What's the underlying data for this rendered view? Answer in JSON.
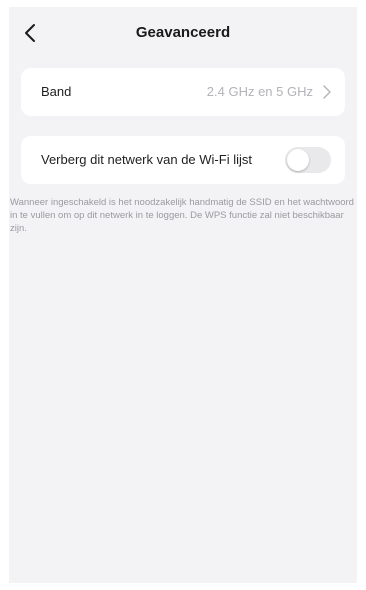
{
  "header": {
    "title": "Geavanceerd",
    "back_icon": "chevron-left-icon"
  },
  "band": {
    "label": "Band",
    "value": "2.4 GHz en 5 GHz",
    "chevron_icon": "chevron-right-icon"
  },
  "hide_network": {
    "label": "Verberg dit netwerk van de Wi-Fi lijst",
    "toggle_on": false
  },
  "hint": {
    "text": "Wanneer ingeschakeld is het noodzakelijk handmatig de SSID en het wachtwoord in te vullen om op dit netwerk in te loggen. De WPS functie zal niet beschikbaar zijn."
  },
  "colors": {
    "background": "#f3f3f5",
    "card": "#ffffff",
    "secondary_text": "#b3b3b8",
    "toggle_off": "#e9e9ec"
  }
}
